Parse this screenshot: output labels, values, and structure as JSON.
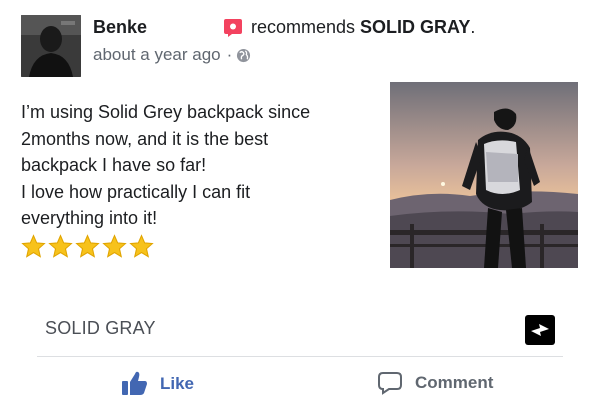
{
  "post": {
    "author": "Benke",
    "recommends_prefix": "recommends",
    "page_name_bold": "SOLID GRAY",
    "recommends_suffix": ".",
    "timestamp": "about a year ago",
    "privacy_separator": "·",
    "text_lines": [
      "I’m using Solid Grey backpack since",
      "2months now, and it is the best",
      "backpack I have so far!",
      "I love how practically I can fit",
      "everything into it!"
    ],
    "rating_stars": 5
  },
  "page": {
    "name": "SOLID GRAY"
  },
  "actions": {
    "like_label": "Like",
    "comment_label": "Comment"
  },
  "colors": {
    "facebook_blue": "#4267b2",
    "recommend_red": "#f3425f",
    "star_yellow": "#f7c21b",
    "secondary_text": "#606770",
    "divider": "#dddfe2"
  },
  "icons": {
    "recommend": "recommend-speech-bubble-icon",
    "privacy": "globe-icon",
    "like": "thumbs-up-icon",
    "comment": "comment-bubble-icon",
    "page_logo": "lightning-bolt-logo"
  }
}
